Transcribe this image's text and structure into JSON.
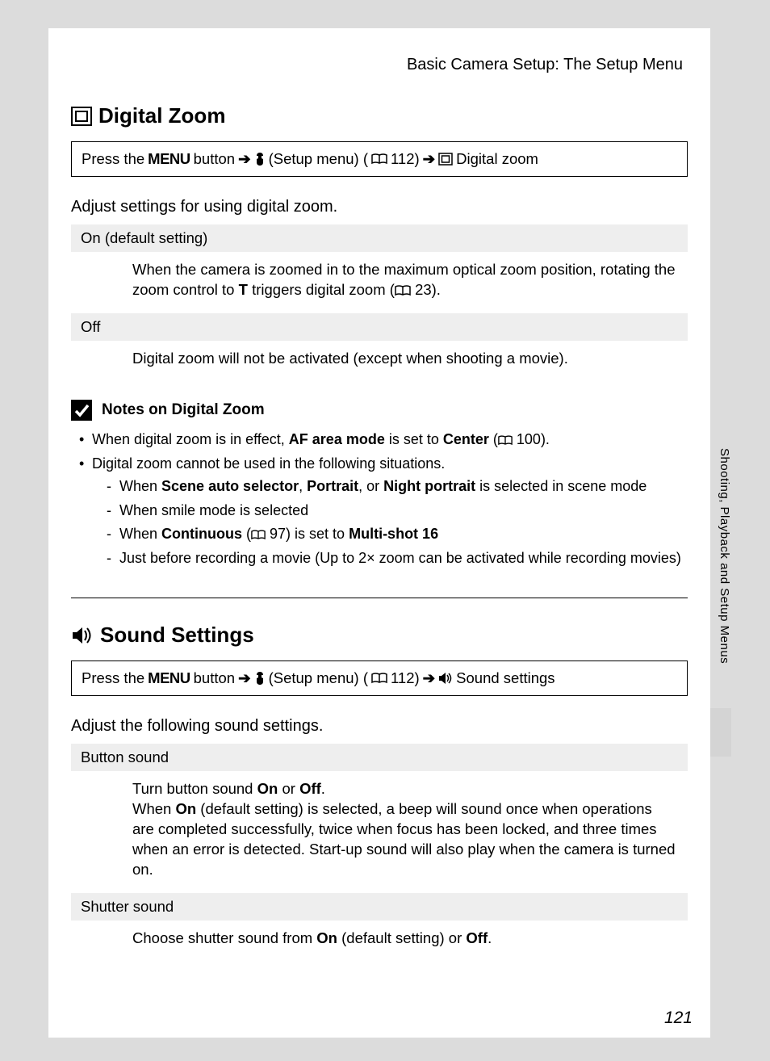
{
  "header": "Basic Camera Setup: The Setup Menu",
  "sidebar_label": "Shooting, Playback and Setup Menus",
  "page_number": "121",
  "section1": {
    "title": "Digital Zoom",
    "nav": {
      "press": "Press the",
      "menu": "MENU",
      "button": "button",
      "setup": "(Setup menu) (",
      "ref112": "112)",
      "end": "Digital zoom"
    },
    "intro": "Adjust settings for using digital zoom.",
    "options": [
      {
        "label": "On (default setting)",
        "desc_pre": "When the camera is zoomed in to the maximum optical zoom position, rotating the zoom control to ",
        "desc_bold": "T",
        "desc_mid": " triggers digital zoom (",
        "desc_ref": "23).",
        "has_book": true
      },
      {
        "label": "Off",
        "desc_pre": "Digital zoom will not be activated (except when shooting a movie).",
        "has_book": false
      }
    ],
    "notes": {
      "title": "Notes on Digital Zoom",
      "bullet1_pre": "When digital zoom is in effect, ",
      "bullet1_b1": "AF area mode",
      "bullet1_mid": " is set to ",
      "bullet1_b2": "Center",
      "bullet1_post": " (",
      "bullet1_ref": "100).",
      "bullet2": "Digital zoom cannot be used in the following situations.",
      "sub1_pre": "When ",
      "sub1_b1": "Scene auto selector",
      "sub1_c": ", ",
      "sub1_b2": "Portrait",
      "sub1_or": ", or ",
      "sub1_b3": "Night portrait",
      "sub1_post": " is selected in scene mode",
      "sub2": "When smile mode is selected",
      "sub3_pre": "When ",
      "sub3_b1": "Continuous",
      "sub3_mid": " (",
      "sub3_ref": "97) is set to ",
      "sub3_b2": "Multi-shot 16",
      "sub4": "Just before recording a movie (Up to 2× zoom can be activated while recording movies)"
    }
  },
  "section2": {
    "title": "Sound Settings",
    "nav": {
      "press": "Press the",
      "menu": "MENU",
      "button": "button",
      "setup": "(Setup menu) (",
      "ref112": "112)",
      "end": "Sound settings"
    },
    "intro": "Adjust the following sound settings.",
    "options": [
      {
        "label": "Button sound",
        "d1_pre": "Turn button sound ",
        "d1_b1": "On",
        "d1_or": " or ",
        "d1_b2": "Off",
        "d1_end": ".",
        "d2_pre": "When ",
        "d2_b1": "On",
        "d2_post": " (default setting) is selected, a beep will sound once when operations are completed successfully, twice when focus has been locked, and three times when an error is detected. Start-up sound will also play when the camera is turned on."
      },
      {
        "label": "Shutter sound",
        "d_pre": "Choose shutter sound from ",
        "d_b1": "On",
        "d_mid": " (default setting) or ",
        "d_b2": "Off",
        "d_end": "."
      }
    ]
  }
}
